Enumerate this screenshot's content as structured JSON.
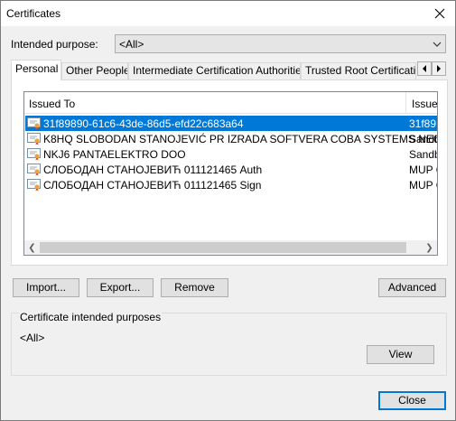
{
  "window": {
    "title": "Certificates",
    "close_icon": "close-icon"
  },
  "intended_purpose": {
    "label": "Intended purpose:",
    "value": "<All>"
  },
  "tabs": [
    {
      "label": "Personal",
      "active": true
    },
    {
      "label": "Other People",
      "active": false
    },
    {
      "label": "Intermediate Certification Authorities",
      "active": false
    },
    {
      "label": "Trusted Root Certification",
      "active": false
    }
  ],
  "cert_list": {
    "columns": [
      "Issued To",
      "Issue"
    ],
    "rows": [
      {
        "issued_to": "31f89890-61c6-43de-86d5-efd22c683a64",
        "issued_by": "31f89",
        "selected": true
      },
      {
        "issued_to": "K8HQ SLOBODAN STANOJEVIĆ PR IZRADA SOFTVERA COBA SYSTEMS NEGOTIN",
        "issued_by": "Sandb",
        "selected": false
      },
      {
        "issued_to": "NKJ6 PANTAELEKTRO DOO",
        "issued_by": "Sandb",
        "selected": false
      },
      {
        "issued_to": "СЛОБОДАН СТАНОЈЕВИЋ 011121465 Auth",
        "issued_by": "MUP C",
        "selected": false
      },
      {
        "issued_to": "СЛОБОДАН СТАНОЈЕВИЋ 011121465 Sign",
        "issued_by": "MUP C",
        "selected": false
      }
    ]
  },
  "buttons": {
    "import": "Import...",
    "export": "Export...",
    "remove": "Remove",
    "advanced": "Advanced",
    "view": "View",
    "close": "Close"
  },
  "purposes_group": {
    "title": "Certificate intended purposes",
    "value": "<All>"
  },
  "colors": {
    "selection": "#0078d7",
    "accent": "#0078d7"
  }
}
